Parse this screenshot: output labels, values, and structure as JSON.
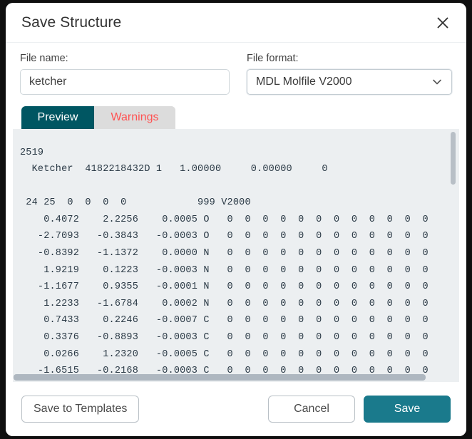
{
  "dialog": {
    "title": "Save Structure",
    "close_icon": "close-icon"
  },
  "fields": {
    "file_name": {
      "label": "File name:",
      "value": "ketcher",
      "placeholder": "File name"
    },
    "file_format": {
      "label": "File format:",
      "value": "MDL Molfile V2000",
      "chevron_icon": "chevron-down-icon"
    }
  },
  "tabs": {
    "preview_label": "Preview",
    "warnings_label": "Warnings",
    "active": "Preview"
  },
  "preview": {
    "content": "2519\n  Ketcher  4182218432D 1   1.00000     0.00000     0\n\n 24 25  0  0  0  0            999 V2000\n    0.4072    2.2256    0.0005 O   0  0  0  0  0  0  0  0  0  0  0  0\n   -2.7093   -0.3843   -0.0003 O   0  0  0  0  0  0  0  0  0  0  0  0\n   -0.8392   -1.1372    0.0000 N   0  0  0  0  0  0  0  0  0  0  0  0\n    1.9219    0.1223   -0.0003 N   0  0  0  0  0  0  0  0  0  0  0  0\n   -1.1677    0.9355   -0.0001 N   0  0  0  0  0  0  0  0  0  0  0  0\n    1.2233   -1.6784    0.0002 N   0  0  0  0  0  0  0  0  0  0  0  0\n    0.7433    0.2246   -0.0007 C   0  0  0  0  0  0  0  0  0  0  0  0\n    0.3376   -0.8893   -0.0003 C   0  0  0  0  0  0  0  0  0  0  0  0\n    0.0266    1.2320   -0.0005 C   0  0  0  0  0  0  0  0  0  0  0  0\n   -1.6515   -0.2168   -0.0003 C   0  0  0  0  0  0  0  0  0  0  0  0"
  },
  "scrollbars": {
    "vertical_thumb": "vertical-scrollbar-thumb",
    "horizontal_thumb": "horizontal-scrollbar-thumb"
  },
  "footer": {
    "save_to_templates_label": "Save to Templates",
    "cancel_label": "Cancel",
    "save_label": "Save"
  },
  "colors": {
    "accent_teal": "#1a7a8c",
    "tab_active": "#005662",
    "warning_red": "#ff5252",
    "preview_bg": "#eceff1"
  }
}
